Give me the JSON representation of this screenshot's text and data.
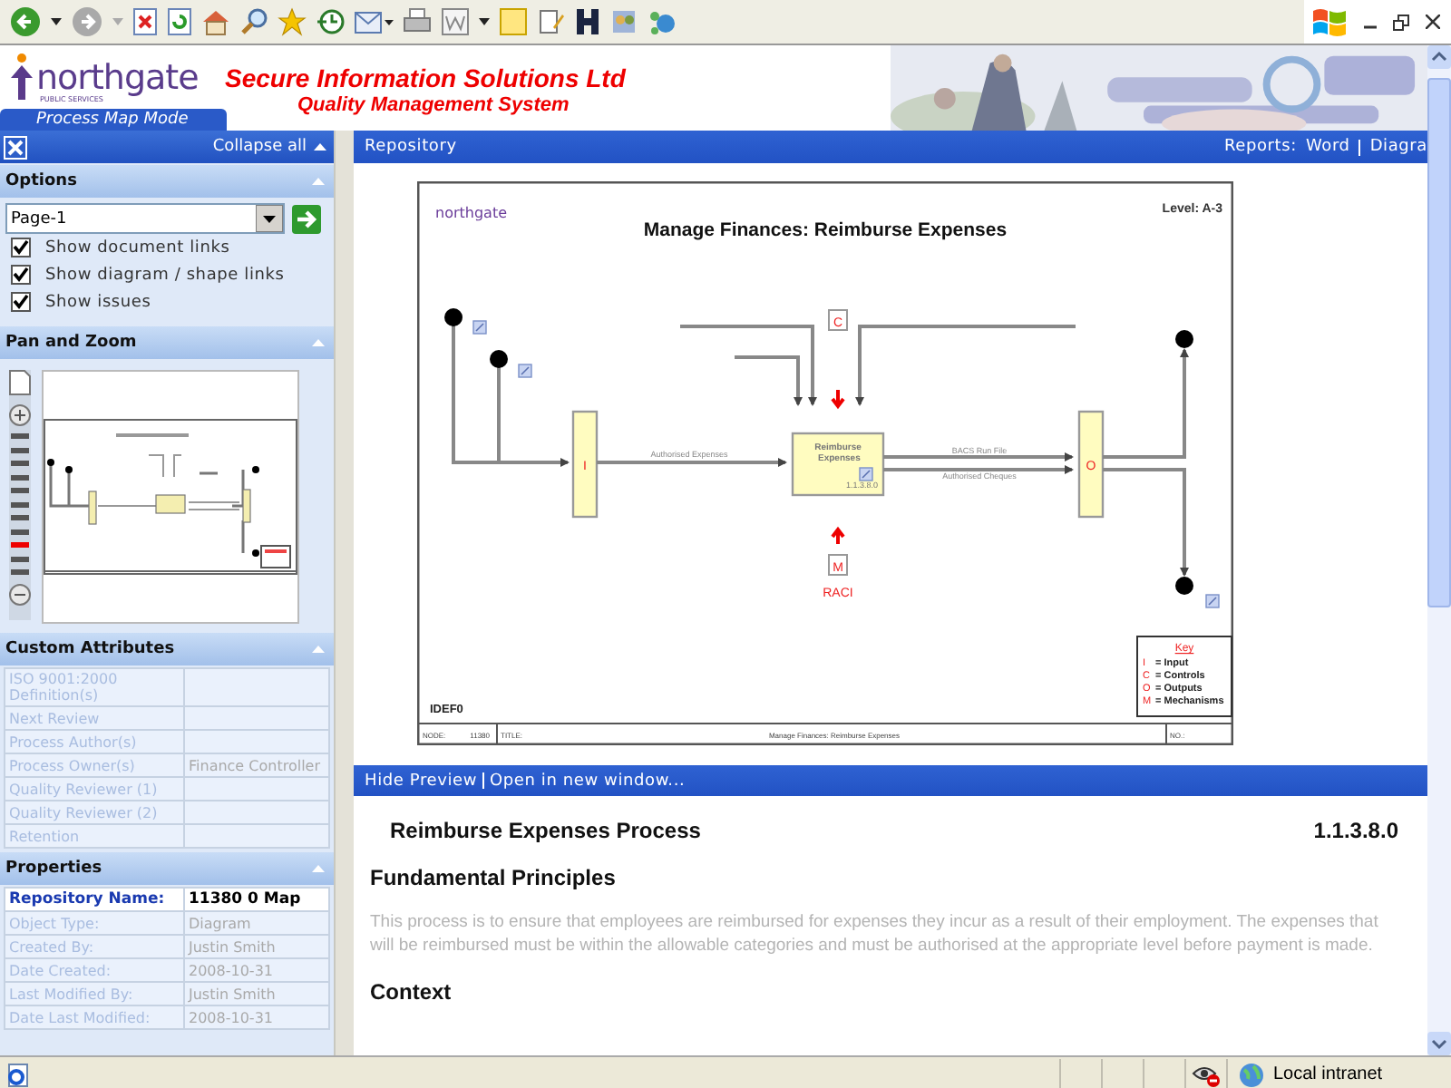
{
  "header": {
    "logo": "northgate",
    "logo_tagline": "PUBLIC SERVICES",
    "company": "Secure Information Solutions Ltd",
    "system": "Quality Management System",
    "mode_tab": "Process Map Mode"
  },
  "sidebar": {
    "collapse_all": "Collapse all",
    "options": {
      "title": "Options",
      "page": "Page-1",
      "checkboxes": [
        {
          "label": "Show document links",
          "checked": true
        },
        {
          "label": "Show diagram / shape links",
          "checked": true
        },
        {
          "label": "Show issues",
          "checked": true
        }
      ]
    },
    "pan_zoom": {
      "title": "Pan and Zoom",
      "zoom_steps": [
        {
          "selected": false
        },
        {
          "selected": false
        },
        {
          "selected": false
        },
        {
          "selected": false
        },
        {
          "selected": false
        },
        {
          "selected": false
        },
        {
          "selected": false
        },
        {
          "selected": false
        },
        {
          "selected": true
        },
        {
          "selected": false
        },
        {
          "selected": false
        }
      ]
    },
    "custom_attributes": {
      "title": "Custom Attributes",
      "rows": [
        {
          "name": "ISO 9001:2000 Definition(s)",
          "value": ""
        },
        {
          "name": "Next Review",
          "value": ""
        },
        {
          "name": "Process Author(s)",
          "value": ""
        },
        {
          "name": "Process Owner(s)",
          "value": "Finance Controller"
        },
        {
          "name": "Quality Reviewer (1)",
          "value": ""
        },
        {
          "name": "Quality Reviewer (2)",
          "value": ""
        },
        {
          "name": "Retention",
          "value": ""
        }
      ]
    },
    "properties": {
      "title": "Properties",
      "rows": [
        {
          "name": "Repository Name:",
          "value": "11380 0 Map",
          "highlight": true
        },
        {
          "name": "Object Type:",
          "value": "Diagram",
          "highlight": false
        },
        {
          "name": "Created By:",
          "value": "Justin Smith",
          "highlight": false
        },
        {
          "name": "Date Created:",
          "value": "2008-10-31",
          "highlight": false
        },
        {
          "name": "Last Modified By:",
          "value": "Justin Smith",
          "highlight": false
        },
        {
          "name": "Date Last Modified:",
          "value": "2008-10-31",
          "highlight": false
        }
      ]
    }
  },
  "content_bar": {
    "location": "Repository",
    "reports_label": "Reports:",
    "reports": [
      "Word",
      "Diagra"
    ]
  },
  "diagram": {
    "logo": "northgate",
    "title": "Manage Finances: Reimburse Expenses",
    "level": "Level: A-3",
    "method": "IDEF0",
    "tunnels": [
      {
        "kind": "input",
        "label": "I"
      },
      {
        "kind": "output",
        "label": "O"
      }
    ],
    "process": {
      "name": "Reimburse Expenses",
      "number": "1.1.3.8.0"
    },
    "control_marker": "C",
    "mechanism_marker": "M",
    "mechanism_label": "RACI",
    "flows": [
      {
        "label": "Authorised Expenses"
      },
      {
        "label": "BACS Run File"
      },
      {
        "label": "Authorised Cheques"
      }
    ],
    "key": {
      "title": "Key",
      "entries": [
        {
          "letter": "I",
          "meaning": "= Input"
        },
        {
          "letter": "C",
          "meaning": "= Controls"
        },
        {
          "letter": "O",
          "meaning": "= Outputs"
        },
        {
          "letter": "M",
          "meaning": "= Mechanisms"
        }
      ]
    },
    "footer": {
      "node_label": "NODE:",
      "node": "11380",
      "title_label": "TITLE:",
      "title": "Manage Finances: Reimburse Expenses",
      "no_label": "NO.:"
    }
  },
  "preview_bar": [
    "Hide Preview",
    "Open in new window..."
  ],
  "document": {
    "title": "Reimburse Expenses Process",
    "number": "1.1.3.8.0",
    "sections": [
      {
        "heading": "Fundamental Principles",
        "text": "This process is to ensure that employees are reimbursed for expenses they incur as a result of their employment.  The expenses that will be reimbursed must be within the allowable categories and must be authorised at the appropriate level before payment is made."
      },
      {
        "heading": "Context"
      }
    ]
  },
  "status_bar": {
    "zone": "Local intranet"
  }
}
